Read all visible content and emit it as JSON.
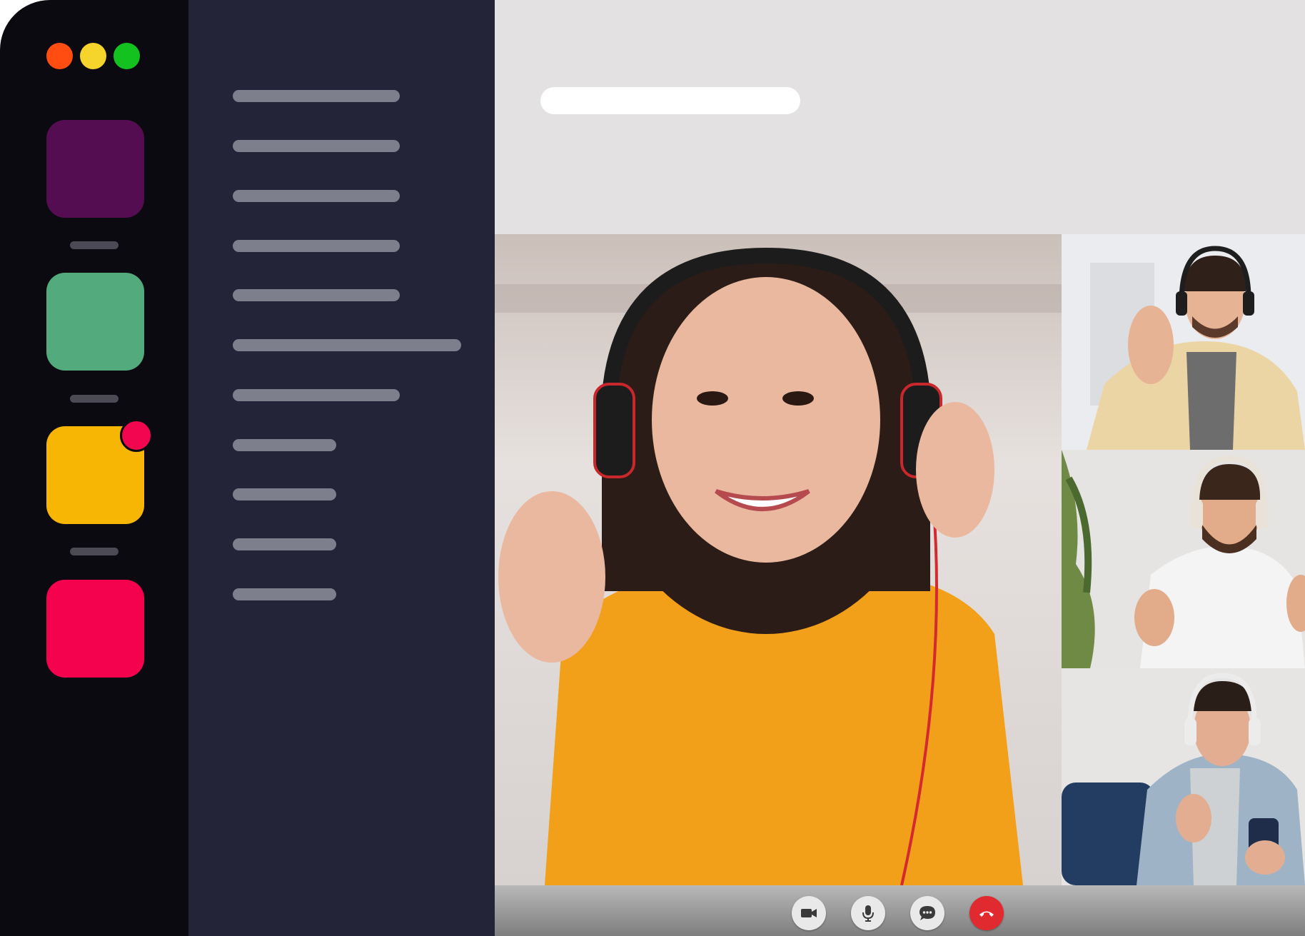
{
  "colors": {
    "rail_bg": "#0b0a10",
    "panel_bg": "#232438",
    "topbar_bg": "#e3e1e2",
    "traffic_red": "#ff4d12",
    "traffic_yellow": "#f5d42b",
    "traffic_green": "#14c21f",
    "workspace_purple": "#540d51",
    "workspace_green": "#52aa7d",
    "workspace_yellow": "#f7b603",
    "workspace_pink": "#f5024f",
    "notification_dot": "#f2064f",
    "end_call_red": "#e02a2f"
  },
  "icons": {
    "camera": "video-camera-icon",
    "mic": "microphone-icon",
    "chat": "chat-bubble-icon",
    "end_call": "phone-hangup-icon"
  },
  "call": {
    "participant_count": 4
  }
}
